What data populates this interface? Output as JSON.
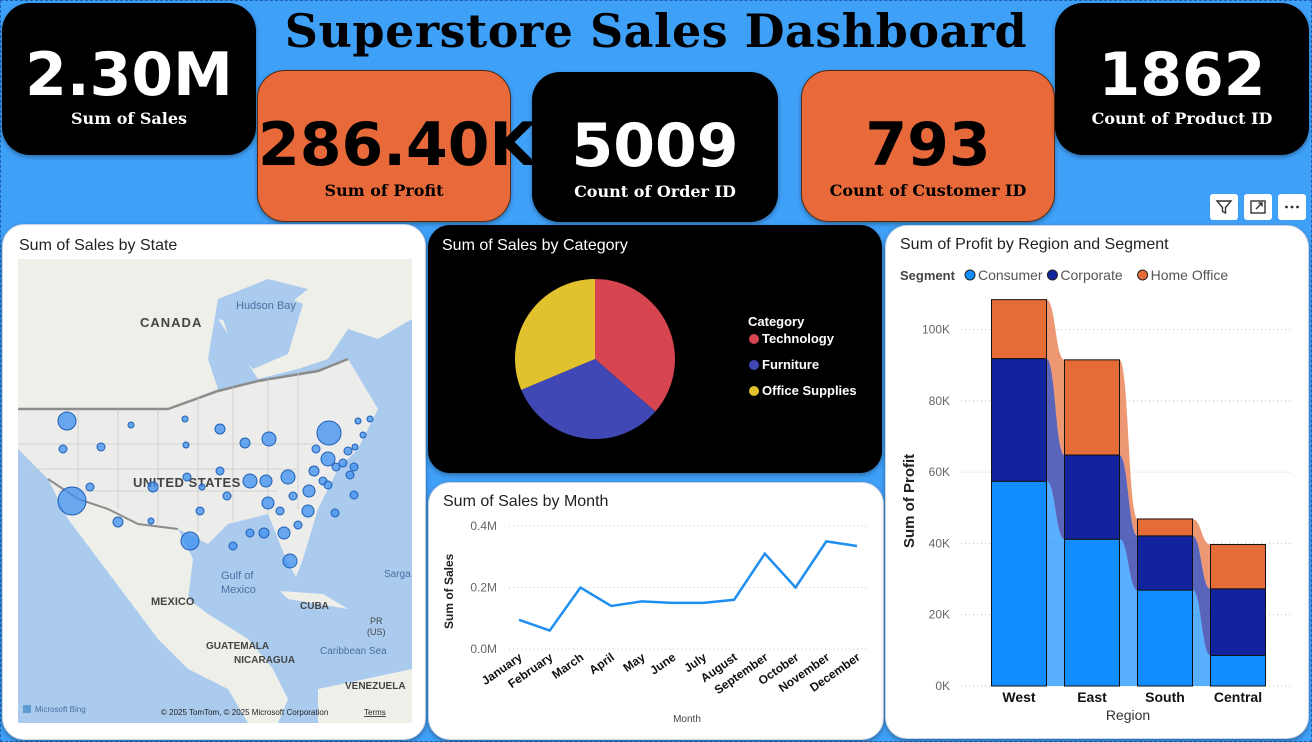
{
  "title": "Superstore Sales Dashboard",
  "kpis": {
    "sales": {
      "value": "2.30M",
      "label": "Sum of Sales"
    },
    "profit": {
      "value": "286.40K",
      "label": "Sum of Profit"
    },
    "orders": {
      "value": "5009",
      "label": "Count of Order ID"
    },
    "customers": {
      "value": "793",
      "label": "Count of Customer ID"
    },
    "products": {
      "value": "1862",
      "label": "Count of Product ID"
    }
  },
  "toolbar": {
    "icons": [
      "filter-icon",
      "focus-mode-icon",
      "more-options-icon"
    ]
  },
  "map": {
    "title": "Sum of Sales by State",
    "labels": {
      "canada": "CANADA",
      "hudson_bay": "Hudson Bay",
      "united_states": "UNITED STATES",
      "mexico": "MEXICO",
      "gulf_of_mexico": "Gulf of Mexico",
      "cuba": "CUBA",
      "guatemala": "GUATEMALA",
      "nicaragua": "NICARAGUA",
      "caribbean_sea": "Caribbean Sea",
      "venezuela": "VENEZUELA",
      "pr": "PR (US)",
      "sarga": "Sarga"
    },
    "attribution": "© 2025 TomTom, © 2025 Microsoft Corporation",
    "terms": "Terms",
    "brand": "Microsoft Bing"
  },
  "chart_data": [
    {
      "type": "pie",
      "title": "Sum of Sales by Category",
      "legend_title": "Category",
      "categories": [
        "Technology",
        "Furniture",
        "Office Supplies"
      ],
      "values": [
        836154,
        741999,
        719047
      ],
      "colors": [
        "#d64550",
        "#3f48b5",
        "#e2c12f"
      ]
    },
    {
      "type": "line",
      "title": "Sum of Sales by Month",
      "xlabel": "Month",
      "ylabel": "Sum of Sales",
      "categories": [
        "January",
        "February",
        "March",
        "April",
        "May",
        "June",
        "July",
        "August",
        "September",
        "October",
        "November",
        "December"
      ],
      "values": [
        95000,
        60000,
        200000,
        140000,
        155000,
        150000,
        150000,
        160000,
        310000,
        200000,
        350000,
        335000
      ],
      "yticks": [
        "0.0M",
        "0.2M",
        "0.4M"
      ],
      "ylim": [
        0,
        400000
      ],
      "color": "#1e8ef0"
    },
    {
      "type": "bar",
      "stacked": true,
      "title": "Sum of Profit by Region and Segment",
      "legend_title": "Segment",
      "xlabel": "Region",
      "ylabel": "Sum of Profit",
      "categories": [
        "West",
        "East",
        "South",
        "Central"
      ],
      "series": [
        {
          "name": "Consumer",
          "values": [
            57450,
            41191,
            26914,
            8564
          ],
          "color": "#118dff"
        },
        {
          "name": "Corporate",
          "values": [
            34437,
            23622,
            15215,
            18704
          ],
          "color": "#12239e"
        },
        {
          "name": "Home Office",
          "values": [
            16531,
            26709,
            4745,
            12438
          ],
          "color": "#e66c37"
        }
      ],
      "yticks": [
        "0K",
        "20K",
        "40K",
        "60K",
        "80K",
        "100K"
      ],
      "ylim": [
        0,
        110000
      ]
    }
  ]
}
